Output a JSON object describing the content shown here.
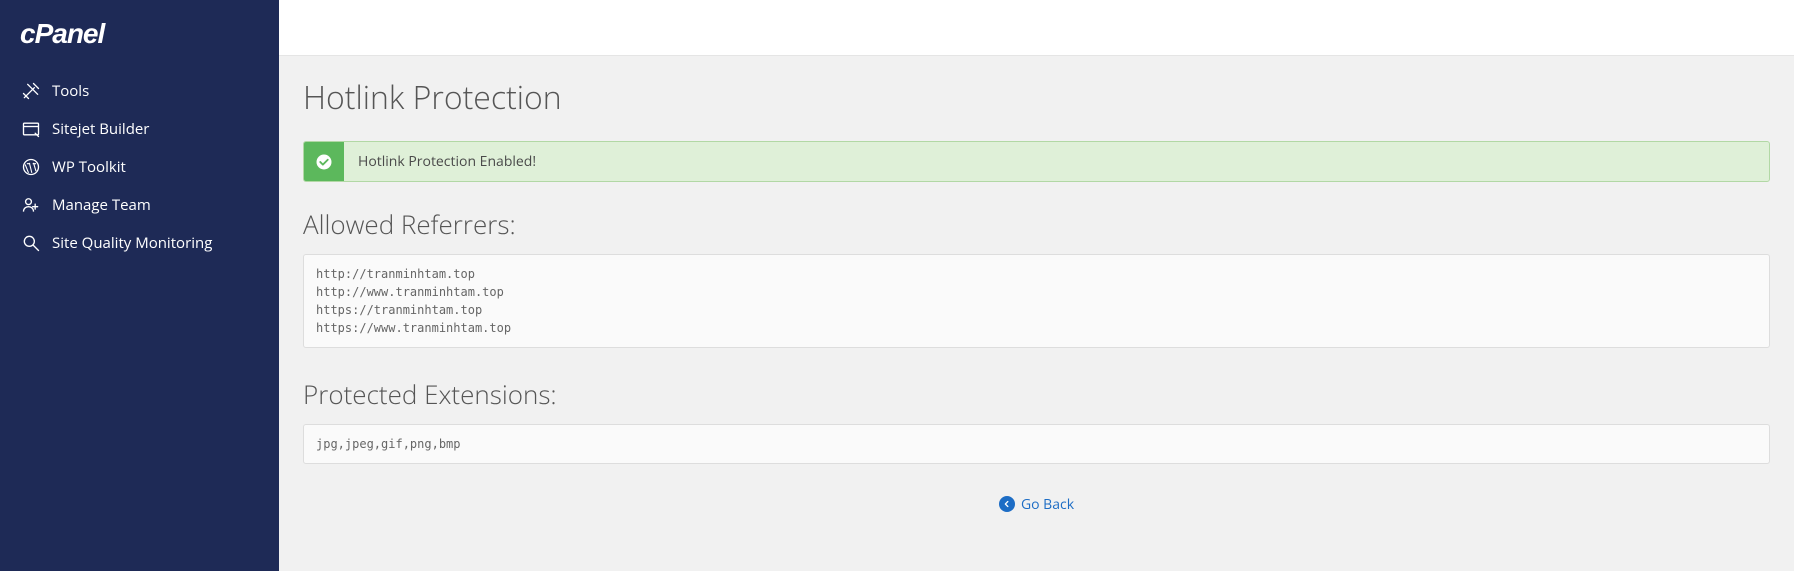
{
  "brand": "cPanel",
  "sidebar": {
    "items": [
      {
        "label": "Tools"
      },
      {
        "label": "Sitejet Builder"
      },
      {
        "label": "WP Toolkit"
      },
      {
        "label": "Manage Team"
      },
      {
        "label": "Site Quality Monitoring"
      }
    ]
  },
  "page": {
    "title": "Hotlink Protection",
    "alert": "Hotlink Protection Enabled!",
    "sections": {
      "referrers_title": "Allowed Referrers:",
      "referrers_content": "http://tranminhtam.top\nhttp://www.tranminhtam.top\nhttps://tranminhtam.top\nhttps://www.tranminhtam.top",
      "extensions_title": "Protected Extensions:",
      "extensions_content": "jpg,jpeg,gif,png,bmp"
    },
    "go_back": "Go Back"
  }
}
